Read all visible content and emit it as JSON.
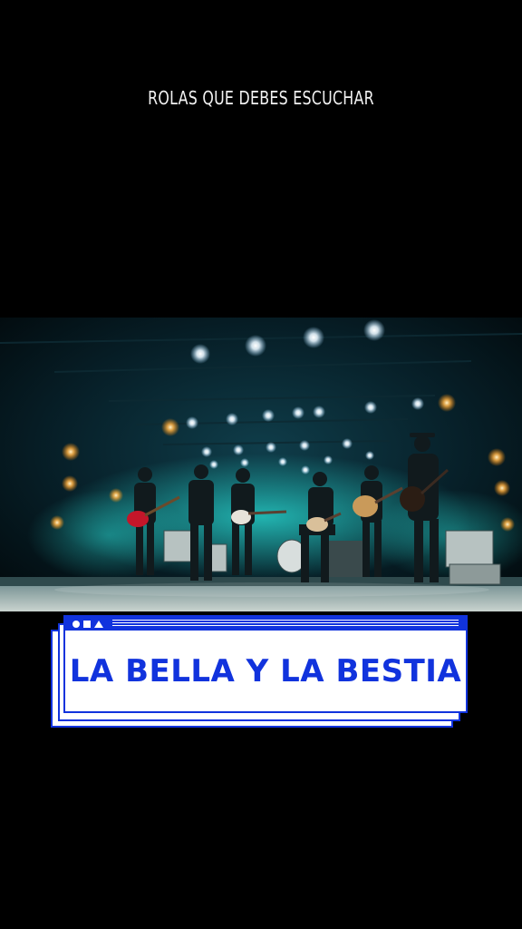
{
  "top_caption": "ROLAS QUE DEBES ESCUCHAR",
  "card": {
    "title": "LA BELLA Y LA BESTIA",
    "header_icons": [
      "circle-icon",
      "square-icon",
      "triangle-icon"
    ]
  },
  "colors": {
    "background": "#000000",
    "accent_blue": "#1133dd",
    "card_bg": "#ffffff",
    "caption_text": "#f2f2f2"
  }
}
